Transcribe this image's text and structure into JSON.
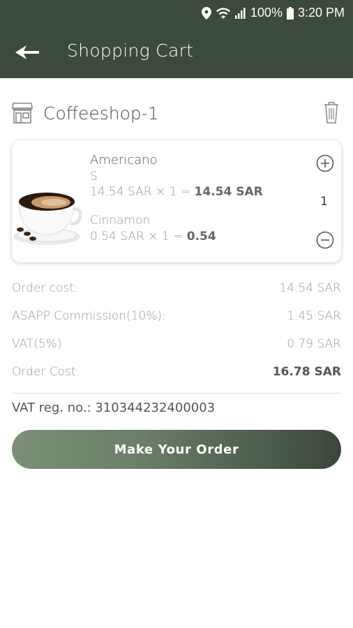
{
  "status_bar": {
    "battery": "100%",
    "time": "3:20 PM",
    "icons": [
      "location-icon",
      "wifi-icon",
      "signal-icon",
      "battery-icon"
    ]
  },
  "app_bar": {
    "title": "Shopping Cart",
    "back_icon": "back-arrow-icon",
    "background_color": "#3b4a3b"
  },
  "shop": {
    "name": "Coffeeshop-1",
    "icon": "store-icon",
    "delete_icon": "trash-icon"
  },
  "cart_items": [
    {
      "name": "Americano",
      "size": "S",
      "price_line_prefix": "14.54 SAR × 1 =",
      "price_line_total": "14.54 SAR",
      "extra_name": "Cinnamon",
      "extra_line_prefix": "0.54 SAR × 1 =",
      "extra_line_total": "0.54",
      "quantity": "1",
      "image": "coffee-cup-image"
    }
  ],
  "summary": {
    "order_cost_label": "Order cost:",
    "order_cost_value": "14.54 SAR",
    "commission_label": "ASAPP Commission(10%):",
    "commission_value": "1.45 SAR",
    "vat_label": "VAT(5%)",
    "vat_value": "0.79 SAR",
    "total_label": "Order Cost:",
    "total_value": "16.78 SAR"
  },
  "vat_registration": "VAT reg. no.: 310344232400003",
  "order_button_label": "Make Your Order",
  "accent_color": "#3b4a3b"
}
